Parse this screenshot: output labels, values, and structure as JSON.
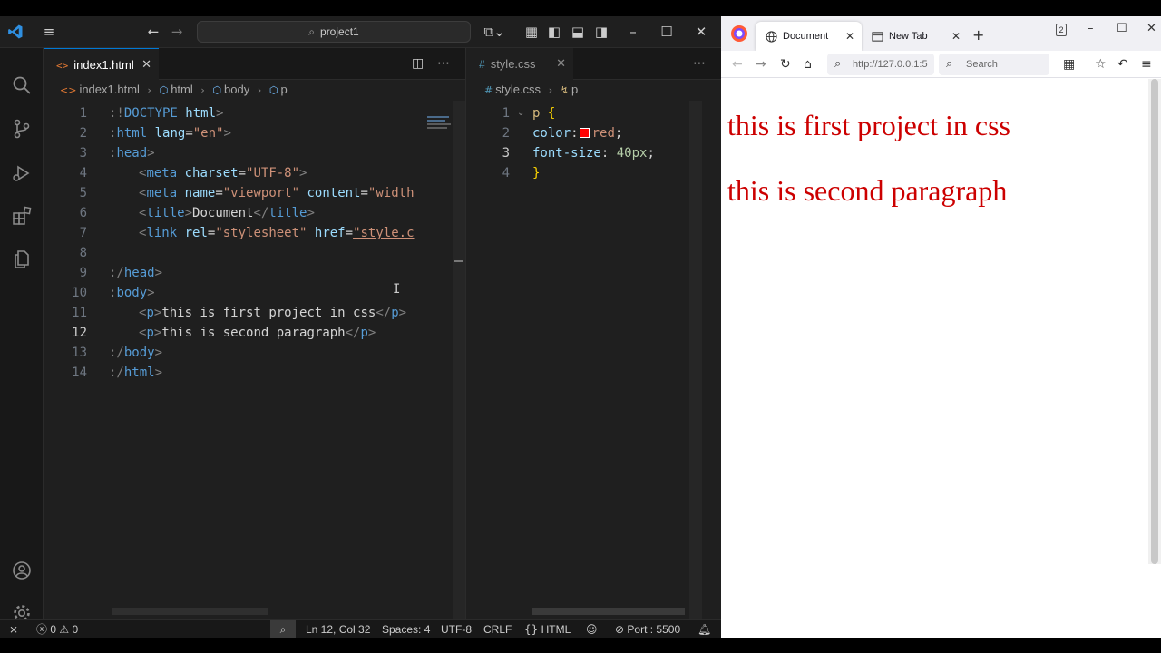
{
  "vscode": {
    "command_center": "project1",
    "editor1": {
      "tab_label": "index1.html",
      "breadcrumb": [
        "index1.html",
        "html",
        "body",
        "p"
      ],
      "current_line": 12,
      "lines": [
        {
          "n": "1"
        },
        {
          "n": "2"
        },
        {
          "n": "3"
        },
        {
          "n": "4"
        },
        {
          "n": "5"
        },
        {
          "n": "6"
        },
        {
          "n": "7"
        },
        {
          "n": "8"
        },
        {
          "n": "9"
        },
        {
          "n": "10"
        },
        {
          "n": "11"
        },
        {
          "n": "12"
        },
        {
          "n": "13"
        },
        {
          "n": "14"
        }
      ],
      "code": {
        "l1_a": ":!",
        "l1_b": "DOCTYPE",
        "l1_c": " html",
        "l1_d": ">",
        "l2_a": ":",
        "l2_b": "html",
        "l2_c": " lang",
        "l2_d": "=",
        "l2_e": "\"en\"",
        "l2_f": ">",
        "l3_a": ":",
        "l3_b": "head",
        "l3_c": ">",
        "l4_a": "<",
        "l4_b": "meta",
        "l4_c": " charset",
        "l4_d": "=",
        "l4_e": "\"UTF-8\"",
        "l4_f": ">",
        "l5_a": "<",
        "l5_b": "meta",
        "l5_c": " name",
        "l5_d": "=",
        "l5_e": "\"viewport\"",
        "l5_f": " content",
        "l5_g": "=",
        "l5_h": "\"width",
        "l6": "",
        "l6_a": "<",
        "l6_b": "title",
        "l6_c": ">",
        "l6_d": "Document",
        "l6_e": "</",
        "l6_f": "title",
        "l6_g": ">",
        "l7_a": "<",
        "l7_b": "link",
        "l7_c": " rel",
        "l7_d": "=",
        "l7_e": "\"stylesheet\"",
        "l7_f": " href",
        "l7_g": "=",
        "l7_h": "\"style.c",
        "l9_a": ":/",
        "l9_b": "head",
        "l9_c": ">",
        "l10_a": ":",
        "l10_b": "body",
        "l10_c": ">",
        "l11_a": "<",
        "l11_b": "p",
        "l11_c": ">",
        "l11_d": "this is first project in css",
        "l11_e": "</",
        "l11_f": "p",
        "l11_g": ">",
        "l12_a": "<",
        "l12_b": "p",
        "l12_c": ">",
        "l12_d": "this is second paragraph",
        "l12_e": "</",
        "l12_f": "p",
        "l12_g": ">",
        "l13_a": ":/",
        "l13_b": "body",
        "l13_c": ">",
        "l14_a": ":/",
        "l14_b": "html",
        "l14_c": ">"
      }
    },
    "editor2": {
      "tab_label": "style.css",
      "tab_hash": "#",
      "breadcrumb": [
        "style.css",
        "p"
      ],
      "lines": [
        {
          "n": "1"
        },
        {
          "n": "2"
        },
        {
          "n": "3"
        },
        {
          "n": "4"
        }
      ],
      "current_line": 3,
      "code": {
        "l1_sel": "p",
        "l1_brace": " {",
        "l2_prop": "color",
        "l2_colon": ":",
        "l2_val": "red",
        "l2_semi": ";",
        "l3_prop": "font-size",
        "l3_colon": ": ",
        "l3_val": "40px",
        "l3_semi": ";",
        "l4_brace": "}"
      },
      "swatch_color": "#ff0000"
    },
    "statusbar": {
      "errors": "0",
      "warnings": "0",
      "position": "Ln 12, Col 32",
      "spaces": "Spaces: 4",
      "encoding": "UTF-8",
      "eol": "CRLF",
      "language": "HTML",
      "port": "Port : 5500"
    }
  },
  "browser": {
    "tabs": [
      {
        "label": "Document"
      },
      {
        "label": "New Tab"
      }
    ],
    "tab_count": "2",
    "url": "http://127.0.0.1:5",
    "search_placeholder": "Search",
    "paragraphs": [
      "this is first project in css",
      "this is second paragraph"
    ],
    "text_color": "#cc0000"
  }
}
